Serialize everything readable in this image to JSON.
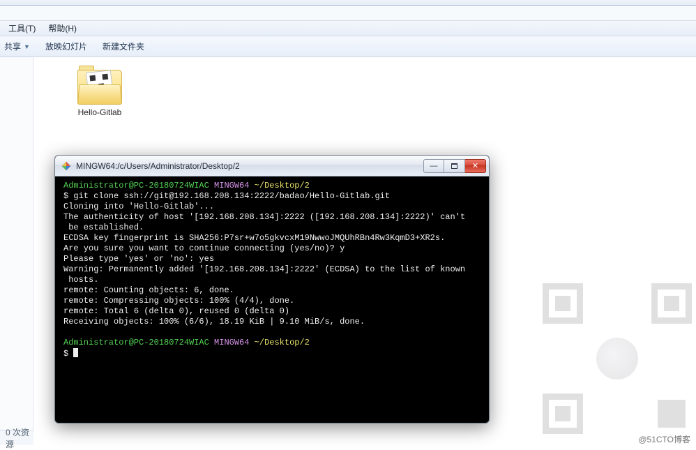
{
  "menubar": {
    "tools": "工具(T)",
    "help": "帮助(H)"
  },
  "toolbar": {
    "share": "共享",
    "slideshow": "放映幻灯片",
    "newfolder": "新建文件夹"
  },
  "folder": {
    "name": "Hello-Gitlab"
  },
  "status": {
    "text": "0 次资源"
  },
  "terminal": {
    "title": "MINGW64:/c/Users/Administrator/Desktop/2",
    "prompt1_userhost": "Administrator@PC-20180724WIAC",
    "prompt1_mingw": "MINGW64",
    "prompt1_path": "~/Desktop/2",
    "cmd1": "$ git clone ssh://git@192.168.208.134:2222/badao/Hello-Gitlab.git",
    "out1": "Cloning into 'Hello-Gitlab'...",
    "out2": "The authenticity of host '[192.168.208.134]:2222 ([192.168.208.134]:2222)' can't",
    "out2b": " be established.",
    "out3": "ECDSA key fingerprint is SHA256:P7sr+w7o5gkvcxM19NwwoJMQUhRBn4Rw3KqmD3+XR2s.",
    "out4": "Are you sure you want to continue connecting (yes/no)? y",
    "out5": "Please type 'yes' or 'no': yes",
    "out6": "Warning: Permanently added '[192.168.208.134]:2222' (ECDSA) to the list of known",
    "out6b": " hosts.",
    "out7": "remote: Counting objects: 6, done.",
    "out8": "remote: Compressing objects: 100% (4/4), done.",
    "out9": "remote: Total 6 (delta 0), reused 0 (delta 0)",
    "out10": "Receiving objects: 100% (6/6), 18.19 KiB | 9.10 MiB/s, done.",
    "prompt2_userhost": "Administrator@PC-20180724WIAC",
    "prompt2_mingw": "MINGW64",
    "prompt2_path": "~/Desktop/2",
    "prompt2_dollar": "$ "
  },
  "watermark": {
    "credit": "@51CTO博客"
  }
}
